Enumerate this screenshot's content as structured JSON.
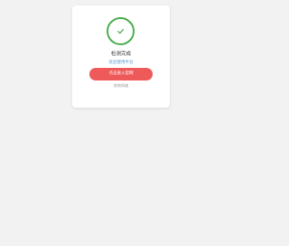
{
  "card": {
    "title": "检测完成",
    "subtitle": "欢迎使用平台",
    "primary_button": "点击进入官网",
    "secondary_link": "其他网络"
  },
  "icons": {
    "status": "check-icon"
  },
  "colors": {
    "success": "#4caf50",
    "primary": "#ee5a5a",
    "subtitle": "#5a9bd5"
  }
}
